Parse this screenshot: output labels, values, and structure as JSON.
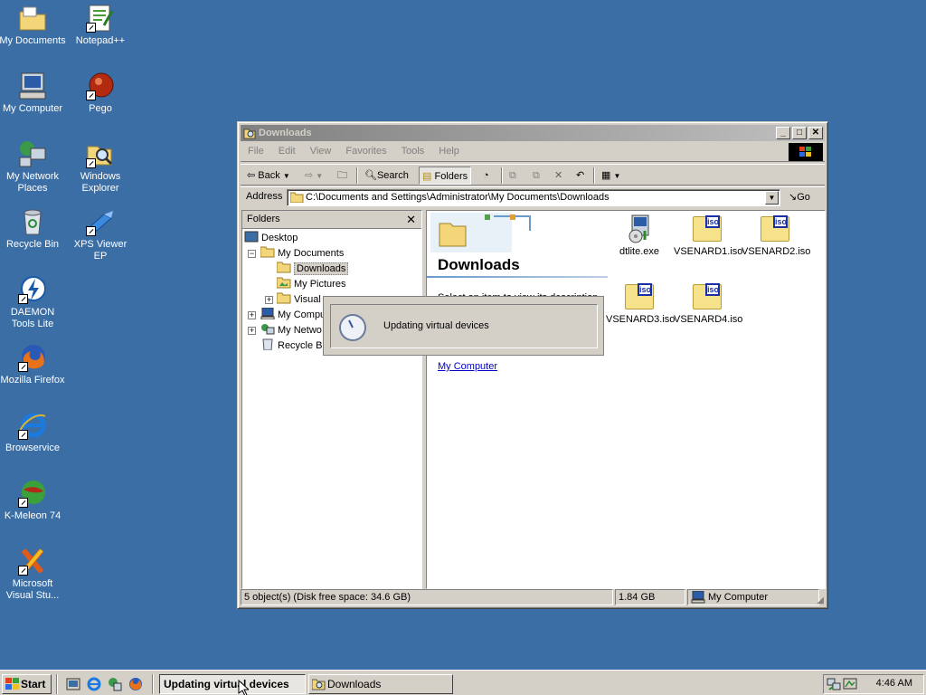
{
  "desktop": {
    "icons": [
      {
        "label": "My Documents"
      },
      {
        "label": "Notepad++"
      },
      {
        "label": "My Computer"
      },
      {
        "label": "Pego"
      },
      {
        "label": "My Network Places"
      },
      {
        "label": "Windows Explorer"
      },
      {
        "label": "Recycle Bin"
      },
      {
        "label": "XPS Viewer EP"
      },
      {
        "label": "DAEMON Tools Lite"
      },
      {
        "label": "Mozilla Firefox"
      },
      {
        "label": "Browservice"
      },
      {
        "label": "K-Meleon 74"
      },
      {
        "label": "Microsoft Visual Stu..."
      }
    ]
  },
  "window": {
    "title": "Downloads",
    "menu": [
      "File",
      "Edit",
      "View",
      "Favorites",
      "Tools",
      "Help"
    ],
    "toolbar": {
      "back": "Back",
      "search": "Search",
      "folders": "Folders"
    },
    "address": {
      "label": "Address",
      "value": "C:\\Documents and Settings\\Administrator\\My Documents\\Downloads",
      "go": "Go"
    },
    "folders_pane": {
      "title": "Folders",
      "tree": [
        "Desktop",
        "My Documents",
        "Downloads",
        "My Pictures",
        "Visual",
        "My Compu",
        "My Netwo",
        "Recycle Bi"
      ]
    },
    "content": {
      "heading": "Downloads",
      "description": "Select an item to view its description.",
      "link": "My Computer",
      "files": [
        "dtlite.exe",
        "VSENARD1.iso",
        "VSENARD2.iso",
        "VSENARD3.iso",
        "VSENARD4.iso"
      ]
    },
    "statusbar": {
      "objects": "5 object(s) (Disk free space: 34.6 GB)",
      "size": "1.84 GB",
      "zone": "My Computer"
    }
  },
  "dialog": {
    "message": "Updating virtual devices"
  },
  "taskbar": {
    "start": "Start",
    "tasks": [
      "Updating virtual devices",
      "Downloads"
    ],
    "clock": "4:46 AM"
  },
  "colors": {
    "desktop": "#3a6ea5",
    "face": "#d4d0c8",
    "title_inactive": "#808080",
    "link": "#0000cc"
  }
}
